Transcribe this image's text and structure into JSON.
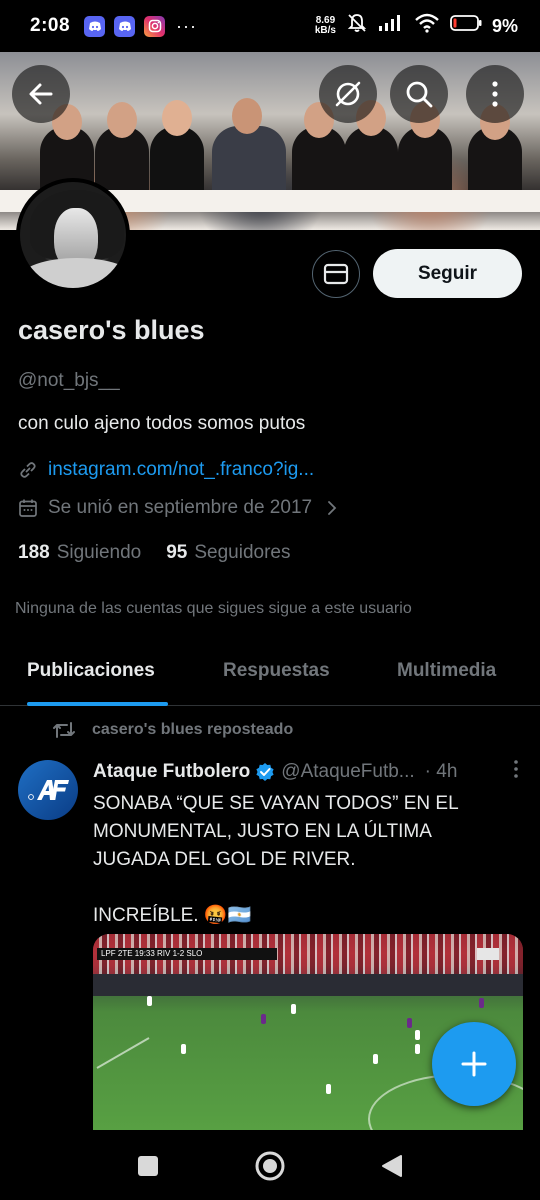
{
  "status_bar": {
    "time": "2:08",
    "more": "···",
    "net_speed_value": "8.69",
    "net_speed_unit": "kB/s",
    "battery": "9%",
    "battery_level": 0.09
  },
  "header": {
    "back_icon": "arrow-left-icon",
    "grok_icon": "grok-icon",
    "search_icon": "search-icon",
    "more_icon": "more-vertical-icon"
  },
  "profile": {
    "name": "casero's blues",
    "handle": "@not_bjs__",
    "bio": "con culo ajeno todos somos putos",
    "link": "instagram.com/not_.franco?ig...",
    "joined": "Se unió en septiembre de 2017",
    "following_count": "188",
    "following_label": "Siguiendo",
    "followers_count": "95",
    "followers_label": "Seguidores",
    "mutual_note": "Ninguna de las cuentas que sigues sigue a este usuario",
    "follow_button": "Seguir"
  },
  "tabs": [
    {
      "label": "Publicaciones",
      "active": true
    },
    {
      "label": "Respuestas",
      "active": false
    },
    {
      "label": "Multimedia",
      "active": false
    }
  ],
  "post": {
    "repost_label": "casero's blues reposteado",
    "author": "Ataque Futbolero",
    "handle": "@AtaqueFutb...",
    "time": "· 4h",
    "line1": "SONABA “QUE SE VAYAN TODOS” EN EL",
    "line2": "MONUMENTAL, JUSTO EN LA ÚLTIMA",
    "line3": "JUGADA DEL GOL DE RIVER.",
    "line4": "INCREÍBLE. 🤬🇦🇷",
    "media_score": "LPF 2TE 19:33 RIV 1-2 SLO"
  },
  "colors": {
    "accent": "#1d9bf0",
    "background": "#000000",
    "text_primary": "#e7e9ea",
    "text_secondary": "#71767b"
  }
}
